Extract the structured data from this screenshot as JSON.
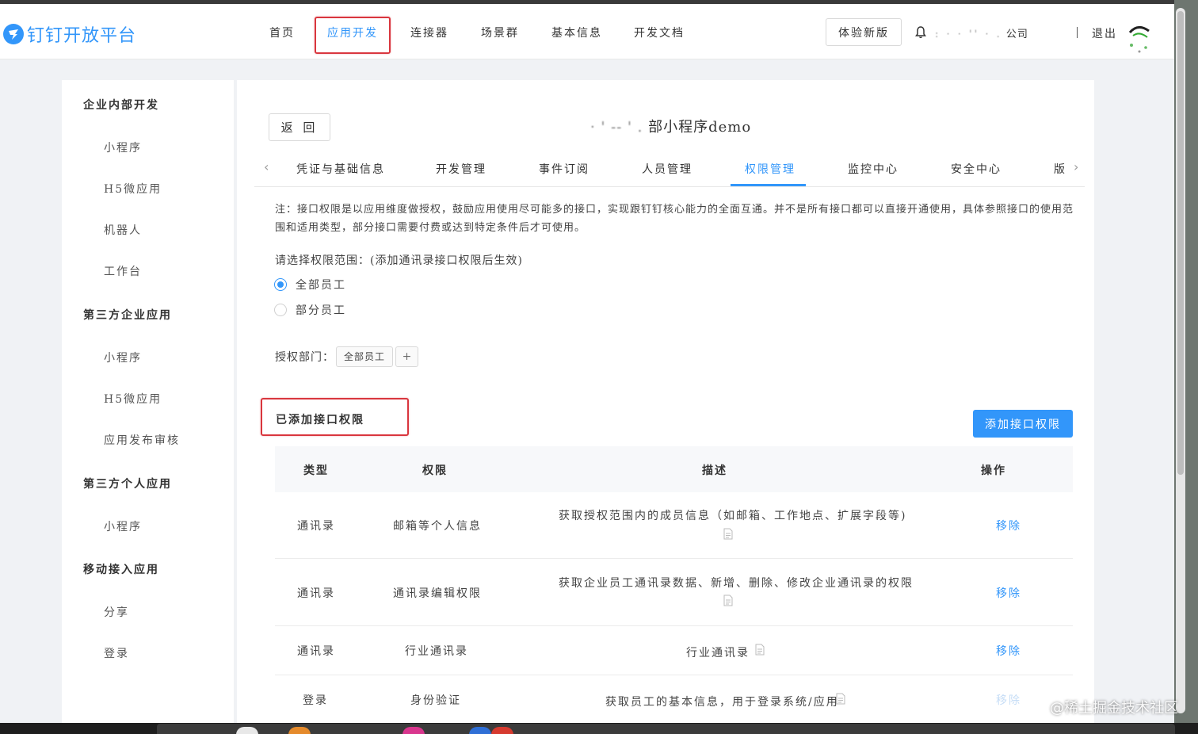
{
  "brand": {
    "name": "钉钉开放平台"
  },
  "nav": {
    "items": [
      "首页",
      "应用开发",
      "连接器",
      "场景群",
      "基本信息",
      "开发文档"
    ],
    "active_index": 1,
    "try_new": "体验新版",
    "company": "公司",
    "logout": "退出"
  },
  "sidebar": {
    "groups": [
      {
        "title": "企业内部开发",
        "items": [
          "小程序",
          "H5微应用",
          "机器人",
          "工作台"
        ]
      },
      {
        "title": "第三方企业应用",
        "items": [
          "小程序",
          "H5微应用",
          "应用发布审核"
        ]
      },
      {
        "title": "第三方个人应用",
        "items": [
          "小程序"
        ]
      },
      {
        "title": "移动接入应用",
        "items": [
          "分享",
          "登录"
        ]
      }
    ]
  },
  "main": {
    "back": "返 回",
    "app_title": "部小程序demo",
    "tabs": [
      "凭证与基础信息",
      "开发管理",
      "事件订阅",
      "人员管理",
      "权限管理",
      "监控中心",
      "安全中心",
      "版"
    ],
    "active_tab": 4,
    "note": "注：接口权限是以应用维度做授权，鼓励应用使用尽可能多的接口，实现跟钉钉核心能力的全面互通。并不是所有接口都可以直接开通使用，具体参照接口的使用范围和适用类型，部分接口需要付费或达到特定条件后才可使用。",
    "scope_label": "请选择权限范围：(添加通讯录接口权限后生效)",
    "scope_options": [
      "全部员工",
      "部分员工"
    ],
    "scope_selected": 0,
    "dept_label": "授权部门：",
    "dept_tag": "全部员工",
    "dept_add": "+",
    "section_title": "已添加接口权限",
    "add_button": "添加接口权限",
    "table": {
      "headers": [
        "类型",
        "权限",
        "描述",
        "操作"
      ],
      "rows": [
        {
          "type": "通讯录",
          "perm": "邮箱等个人信息",
          "desc": "获取授权范围内的成员信息（如邮箱、工作地点、扩展字段等)",
          "action": "移除"
        },
        {
          "type": "通讯录",
          "perm": "通讯录编辑权限",
          "desc": "获取企业员工通讯录数据、新增、删除、修改企业通讯录的权限",
          "action": "移除"
        },
        {
          "type": "通讯录",
          "perm": "行业通讯录",
          "desc": "行业通讯录",
          "action": "移除"
        },
        {
          "type": "登录",
          "perm": "身份验证",
          "desc": "获取员工的基本信息，用于登录系统/应用",
          "action": "移除"
        }
      ]
    }
  },
  "watermark": "@稀土掘金技术社区",
  "colors": {
    "accent": "#3296fa",
    "highlight_box": "#d9363e"
  }
}
